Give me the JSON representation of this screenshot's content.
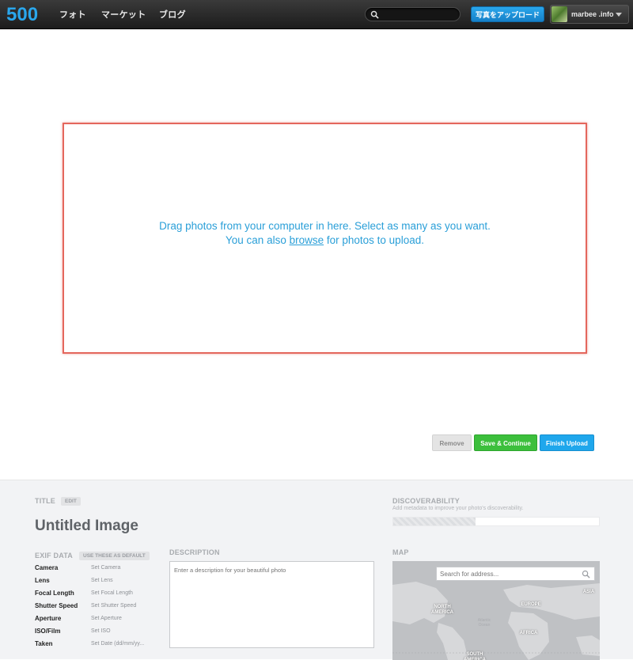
{
  "nav": {
    "logo_text": "500",
    "links": [
      "フォト",
      "マーケット",
      "ブログ"
    ],
    "search_placeholder": "",
    "upload_label": "写真をアップロード",
    "user_name": "marbee .info"
  },
  "dropzone": {
    "line1": "Drag photos from your computer in here. Select as many as you want.",
    "line2_prefix": "You can also ",
    "line2_link": "browse",
    "line2_suffix": " for photos to upload."
  },
  "actions": {
    "remove": "Remove",
    "save": "Save & Continue",
    "finish": "Finish Upload"
  },
  "form": {
    "title_label": "TITLE",
    "edit_label": "EDIT",
    "title_value": "Untitled Image",
    "discoverability_label": "DISCOVERABILITY",
    "discoverability_hint": "Add metadata to improve your photo's discoverability.",
    "discoverability_level": 0.4,
    "exif_label": "EXIF DATA",
    "exif_default_label": "USE THESE AS DEFAULT",
    "exif": [
      {
        "key": "Camera",
        "value": "Set Camera"
      },
      {
        "key": "Lens",
        "value": "Set Lens"
      },
      {
        "key": "Focal Length",
        "value": "Set Focal Length"
      },
      {
        "key": "Shutter Speed",
        "value": "Set Shutter Speed"
      },
      {
        "key": "Aperture",
        "value": "Set Aperture"
      },
      {
        "key": "ISO/Film",
        "value": "Set ISO"
      },
      {
        "key": "Taken",
        "value": "Set Date (dd/mm/yy..."
      }
    ],
    "description_label": "DESCRIPTION",
    "description_placeholder": "Enter a description for your beautiful photo",
    "map_label": "MAP",
    "map_search_placeholder": "Search for address...",
    "map_regions": {
      "north_america": "NORTH\nAMERICA",
      "europe": "EUROPE",
      "asia": "ASIA",
      "africa": "AFRICA",
      "south_america": "SOUTH\nAMERICA",
      "ocean": "Atlantic\nOcean"
    }
  },
  "colors": {
    "accent_blue": "#2a9fd8",
    "drop_border": "#e4675d",
    "save_green": "#3cbf3c",
    "finish_blue": "#1fa7ec"
  }
}
